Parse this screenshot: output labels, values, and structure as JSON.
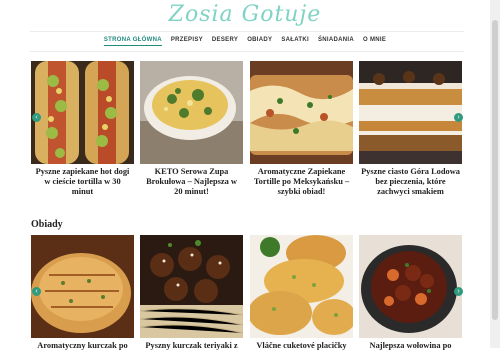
{
  "site": {
    "logo": "Zosia Gotuje"
  },
  "nav": {
    "items": [
      {
        "label": "STRONA GŁÓWNA",
        "active": true
      },
      {
        "label": "PRZEPISY",
        "active": false
      },
      {
        "label": "DESERY",
        "active": false
      },
      {
        "label": "OBIADY",
        "active": false
      },
      {
        "label": "SAŁATKI",
        "active": false
      },
      {
        "label": "ŚNIADANIA",
        "active": false
      },
      {
        "label": "O MNIE",
        "active": false
      }
    ]
  },
  "featured": {
    "cards": [
      {
        "title": "Pyszne zapiekane hot dogi w cieście tortilla w 30 minut",
        "image": "hot-dog-tortilla-photo"
      },
      {
        "title": "KETO Serowa Zupa Brokułowa – Najlepsza w 20 minut!",
        "image": "broccoli-soup-photo"
      },
      {
        "title": "Aromatyczne Zapiekane Tortille po Meksykańsku – szybki obiad!",
        "image": "baked-tortilla-photo"
      },
      {
        "title": "Pyszne ciasto Góra Lodowa bez pieczenia, które zachwyci smakiem",
        "image": "layer-cake-photo"
      }
    ]
  },
  "obiady": {
    "heading": "Obiady",
    "cards": [
      {
        "title": "Aromatyczny kurczak po",
        "image": "bread-chicken-photo"
      },
      {
        "title": "Pyszny kurczak teriyaki z",
        "image": "teriyaki-chicken-photo"
      },
      {
        "title": "Vláčne cuketové placičky",
        "image": "zucchini-fritters-photo"
      },
      {
        "title": "Najlepsza wołowina po",
        "image": "beef-stew-photo"
      }
    ]
  },
  "colors": {
    "accent": "#2f9a7f",
    "logo": "#7fd3c4"
  },
  "icons": {
    "prev": "chevron-left-icon",
    "next": "chevron-right-icon"
  }
}
